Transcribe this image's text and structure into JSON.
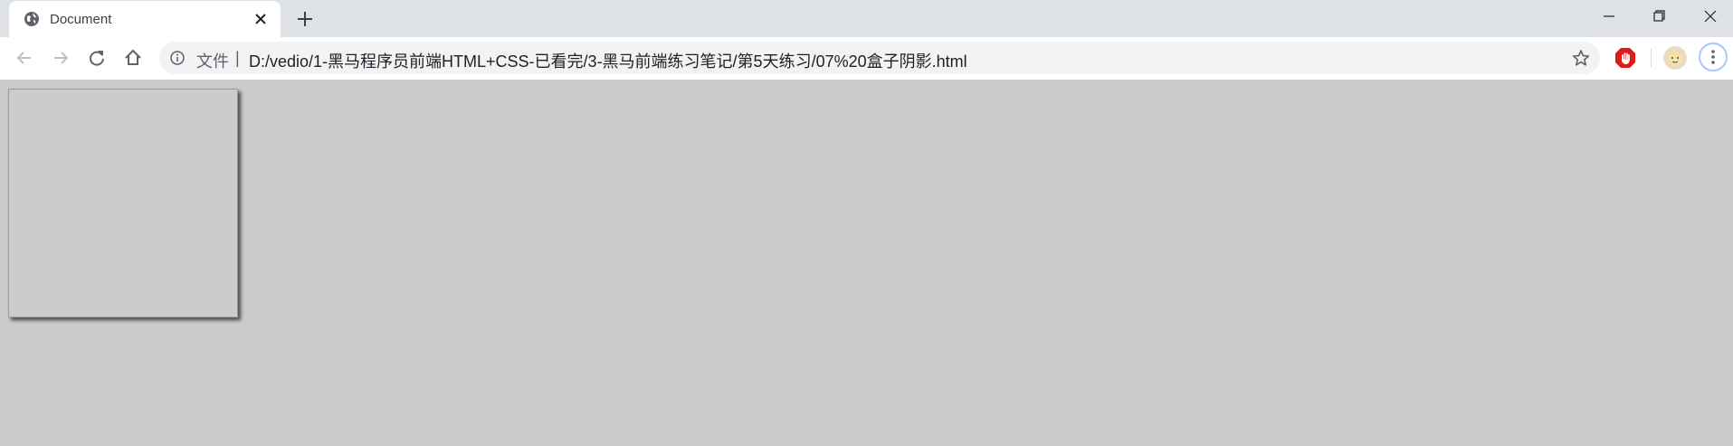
{
  "window": {
    "tab": {
      "title": "Document",
      "favicon": "globe-icon",
      "close_icon": "close-icon"
    },
    "new_tab_icon": "plus-icon",
    "controls": [
      "minimize-icon",
      "restore-icon",
      "close-window-icon"
    ]
  },
  "toolbar": {
    "back_icon": "back-arrow-icon",
    "forward_icon": "forward-arrow-icon",
    "reload_icon": "reload-icon",
    "home_icon": "home-icon",
    "omnibox": {
      "security_icon": "info-icon",
      "scheme_label": "文件",
      "separator": "|",
      "url": "D:/vedio/1-黑马程序员前端HTML+CSS-已看完/3-黑马前端练习笔记/第5天练习/07%20盒子阴影.html",
      "bookmark_icon": "star-icon"
    },
    "extension_icon": "adblock-hand-icon",
    "profile_icon": "avatar",
    "menu_icon": "kebab-menu-icon"
  },
  "page": {
    "element": "shadow-box",
    "colors": {
      "background": "#cccccc",
      "shadow": "#4a4a4a"
    }
  }
}
